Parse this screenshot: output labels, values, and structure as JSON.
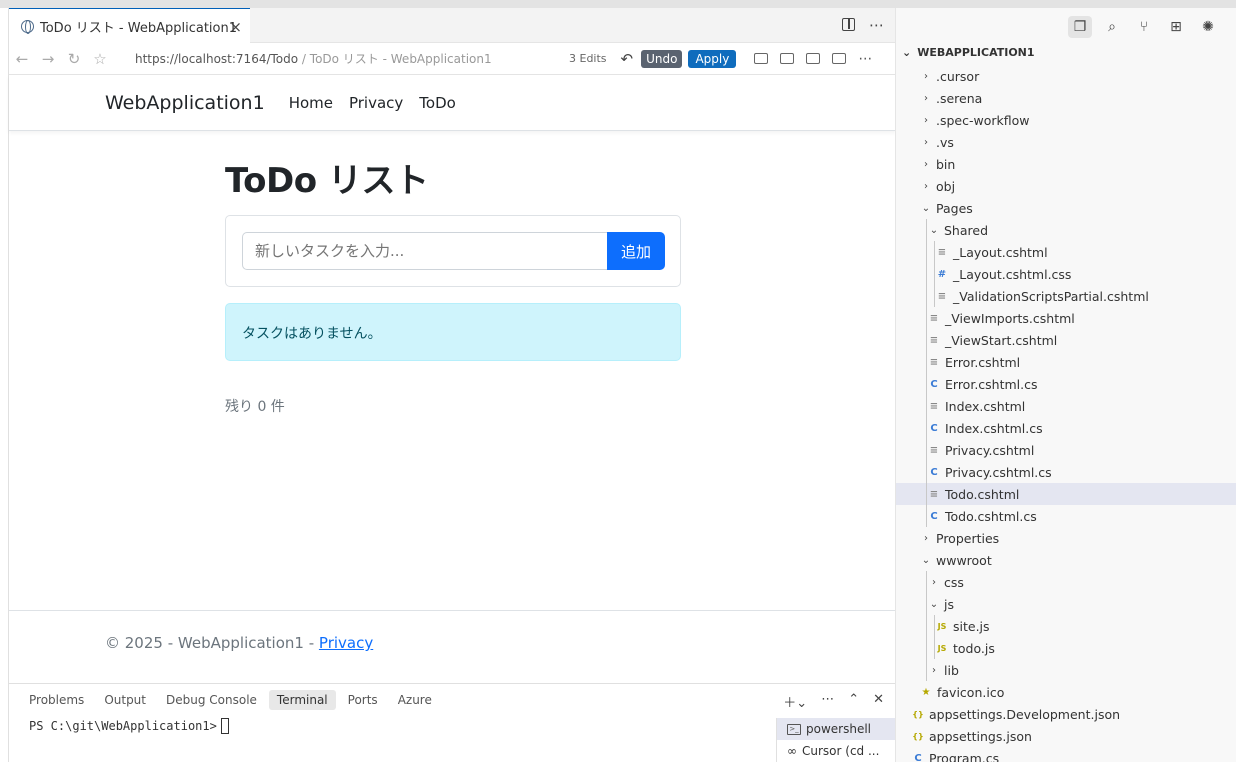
{
  "browser": {
    "tab_title": "ToDo リスト - WebApplication1",
    "url_host": "https://localhost:7164/Todo",
    "url_suffix": " / ToDo リスト - WebApplication1",
    "edits": "3 Edits",
    "undo": "Undo",
    "apply": "Apply"
  },
  "site": {
    "brand": "WebApplication1",
    "nav": [
      "Home",
      "Privacy",
      "ToDo"
    ],
    "heading": "ToDo リスト",
    "input_placeholder": "新しいタスクを入力...",
    "add_button": "追加",
    "empty_message": "タスクはありません。",
    "remaining": "残り 0 件",
    "footer_prefix": "© 2025 - WebApplication1 - ",
    "footer_link": "Privacy"
  },
  "panel": {
    "tabs": [
      "Problems",
      "Output",
      "Debug Console",
      "Terminal",
      "Ports",
      "Azure"
    ],
    "active_tab": "Terminal",
    "prompt": "PS C:\\git\\WebApplication1>",
    "terminals": [
      "powershell",
      "Cursor (cd ..."
    ]
  },
  "explorer": {
    "title": "WEBAPPLICATION1",
    "items": [
      {
        "label": ".cursor",
        "type": "folder"
      },
      {
        "label": ".serena",
        "type": "folder"
      },
      {
        "label": ".spec-workflow",
        "type": "folder"
      },
      {
        "label": ".vs",
        "type": "folder"
      },
      {
        "label": "bin",
        "type": "folder"
      },
      {
        "label": "obj",
        "type": "folder"
      },
      {
        "label": "Pages",
        "type": "folder-open"
      },
      {
        "label": "Shared",
        "type": "folder-open"
      },
      {
        "label": "_Layout.cshtml",
        "type": "file"
      },
      {
        "label": "_Layout.cshtml.css",
        "type": "css"
      },
      {
        "label": "_ValidationScriptsPartial.cshtml",
        "type": "file"
      },
      {
        "label": "_ViewImports.cshtml",
        "type": "file"
      },
      {
        "label": "_ViewStart.cshtml",
        "type": "file"
      },
      {
        "label": "Error.cshtml",
        "type": "file"
      },
      {
        "label": "Error.cshtml.cs",
        "type": "cs"
      },
      {
        "label": "Index.cshtml",
        "type": "file"
      },
      {
        "label": "Index.cshtml.cs",
        "type": "cs"
      },
      {
        "label": "Privacy.cshtml",
        "type": "file"
      },
      {
        "label": "Privacy.cshtml.cs",
        "type": "cs"
      },
      {
        "label": "Todo.cshtml",
        "type": "file"
      },
      {
        "label": "Todo.cshtml.cs",
        "type": "cs"
      },
      {
        "label": "Properties",
        "type": "folder"
      },
      {
        "label": "wwwroot",
        "type": "folder-open"
      },
      {
        "label": "css",
        "type": "folder"
      },
      {
        "label": "js",
        "type": "folder-open"
      },
      {
        "label": "site.js",
        "type": "js"
      },
      {
        "label": "todo.js",
        "type": "js"
      },
      {
        "label": "lib",
        "type": "folder"
      },
      {
        "label": "favicon.ico",
        "type": "star"
      },
      {
        "label": "appsettings.Development.json",
        "type": "json"
      },
      {
        "label": "appsettings.json",
        "type": "json"
      },
      {
        "label": "Program.cs",
        "type": "cs"
      }
    ],
    "selected": "Todo.cshtml"
  }
}
